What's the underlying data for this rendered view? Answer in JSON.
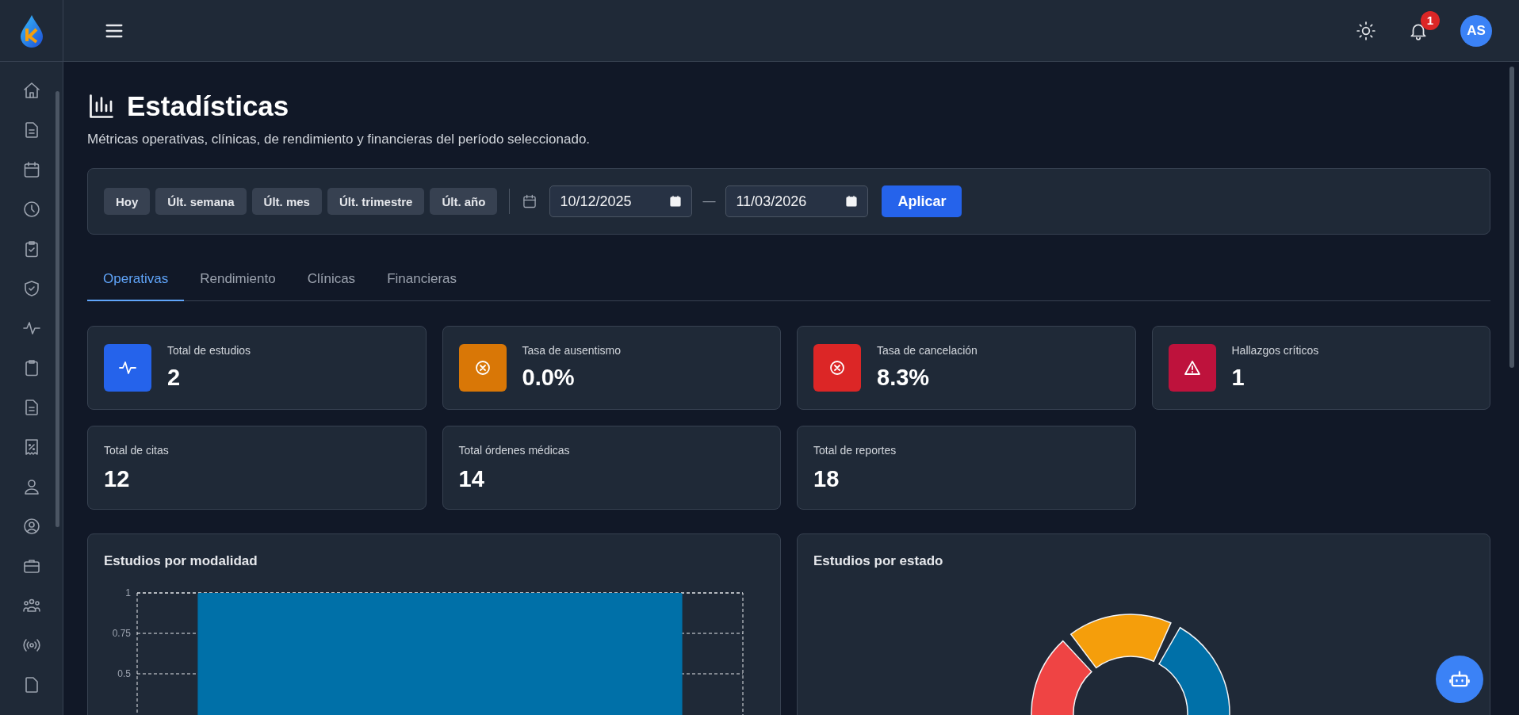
{
  "header": {
    "notification_count": "1",
    "avatar_initials": "AS"
  },
  "page": {
    "title": "Estadísticas",
    "subtitle": "Métricas operativas, clínicas, de rendimiento y financieras del período seleccionado."
  },
  "filters": {
    "presets": [
      "Hoy",
      "Últ. semana",
      "Últ. mes",
      "Últ. trimestre",
      "Últ. año"
    ],
    "date_from": "10/12/2025",
    "separator": "—",
    "date_to": "11/03/2026",
    "apply_button": "Aplicar"
  },
  "tabs": [
    {
      "label": "Operativas",
      "selected": true
    },
    {
      "label": "Rendimiento",
      "selected": false
    },
    {
      "label": "Clínicas",
      "selected": false
    },
    {
      "label": "Financieras",
      "selected": false
    }
  ],
  "stats": [
    {
      "kind": "pulse",
      "label": "Total de estudios",
      "value": "2",
      "color": "#2563eb"
    },
    {
      "kind": "cancel",
      "label": "Tasa de ausentismo",
      "value": "0.0%",
      "color": "#d97706"
    },
    {
      "kind": "cancel",
      "label": "Tasa de cancelación",
      "value": "8.3%",
      "color": "#dc2626"
    },
    {
      "kind": "warning",
      "label": "Hallazgos críticos",
      "value": "1",
      "color": "#be123c"
    },
    {
      "kind": "plain",
      "label": "Total de citas",
      "value": "12"
    },
    {
      "kind": "plain",
      "label": "Total órdenes médicas",
      "value": "14"
    },
    {
      "kind": "plain",
      "label": "Total de reportes",
      "value": "18"
    }
  ],
  "charts": [
    {
      "kind": "bar",
      "title": "Estudios por modalidad",
      "chart_data": {
        "type": "bar",
        "values": [
          1
        ],
        "ylim": [
          0,
          1
        ],
        "yticks": [
          0.5,
          0.75,
          1
        ]
      }
    },
    {
      "kind": "donut",
      "title": "Estudios por estado"
    }
  ]
}
